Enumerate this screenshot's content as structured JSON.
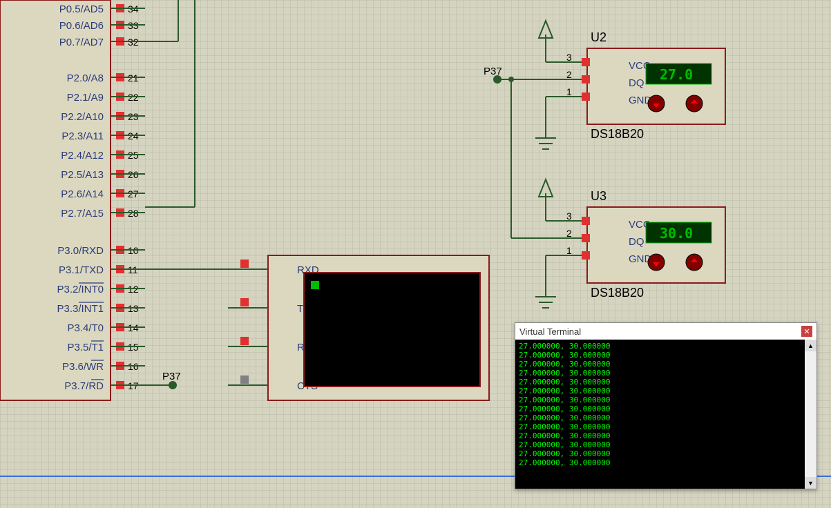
{
  "mcu": {
    "pins_top": [
      {
        "name": "P0.5/AD5",
        "num": "34"
      },
      {
        "name": "P0.6/AD6",
        "num": "33"
      },
      {
        "name": "P0.7/AD7",
        "num": "32"
      }
    ],
    "pins_p2": [
      {
        "name": "P2.0/A8",
        "num": "21"
      },
      {
        "name": "P2.1/A9",
        "num": "22"
      },
      {
        "name": "P2.2/A10",
        "num": "23"
      },
      {
        "name": "P2.3/A11",
        "num": "24"
      },
      {
        "name": "P2.4/A12",
        "num": "25"
      },
      {
        "name": "P2.5/A13",
        "num": "26"
      },
      {
        "name": "P2.6/A14",
        "num": "27"
      },
      {
        "name": "P2.7/A15",
        "num": "28"
      }
    ],
    "pins_p3": [
      {
        "name": "P3.0/RXD",
        "num": "10"
      },
      {
        "name": "P3.1/TXD",
        "num": "11"
      },
      {
        "name": "P3.2/INT0",
        "num": "12"
      },
      {
        "name": "P3.3/INT1",
        "num": "13"
      },
      {
        "name": "P3.4/T0",
        "num": "14"
      },
      {
        "name": "P3.5/T1",
        "num": "15"
      },
      {
        "name": "P3.6/WR",
        "num": "16"
      },
      {
        "name": "P3.7/RD",
        "num": "17"
      }
    ]
  },
  "uart": {
    "pins": [
      "RXD",
      "TXD",
      "RTS",
      "CTS"
    ]
  },
  "u2": {
    "ref": "U2",
    "type": "DS18B20",
    "pins": [
      "VCC",
      "DQ",
      "GND"
    ],
    "pin_nums": [
      "3",
      "2",
      "1"
    ],
    "reading": "27.0"
  },
  "u3": {
    "ref": "U3",
    "type": "DS18B20",
    "pins": [
      "VCC",
      "DQ",
      "GND"
    ],
    "pin_nums": [
      "3",
      "2",
      "1"
    ],
    "reading": "30.0"
  },
  "net_label": "P37",
  "terminal": {
    "title": "Virtual Terminal",
    "lines": [
      "27.000000, 30.000000",
      "27.000000, 30.000000",
      "27.000000, 30.000000",
      "27.000000, 30.000000",
      "27.000000, 30.000000",
      "27.000000, 30.000000",
      "27.000000, 30.000000",
      "27.000000, 30.000000",
      "27.000000, 30.000000",
      "27.000000, 30.000000",
      "27.000000, 30.000000",
      "27.000000, 30.000000",
      "27.000000, 30.000000",
      "27.000000, 30.000000"
    ]
  }
}
